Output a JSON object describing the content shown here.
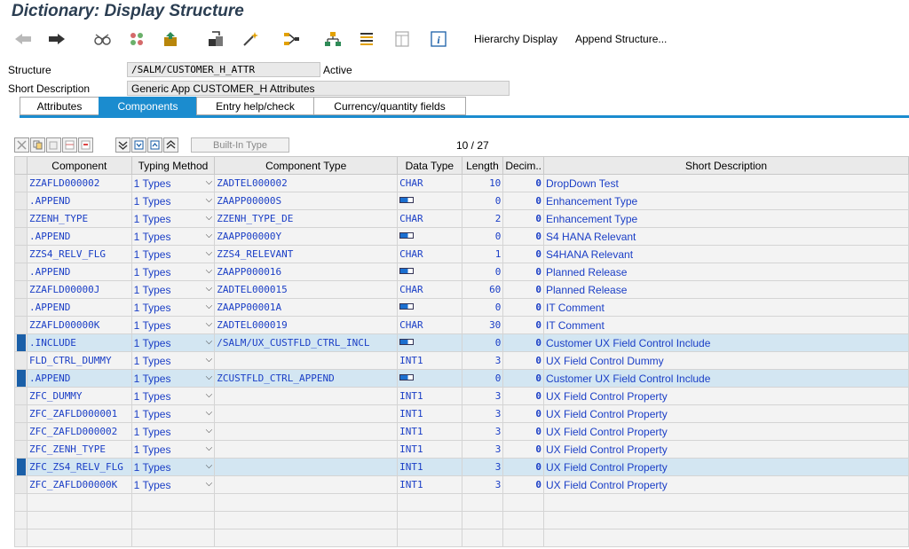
{
  "window": {
    "title": "Dictionary: Display Structure"
  },
  "toolbar": {
    "icons": [
      "back-arrow-icon",
      "forward-arrow-icon",
      "glasses-icon",
      "switch-display-change-icon",
      "other-object-icon",
      "check-icon",
      "activate-icon",
      "where-used-icon",
      "hierarchy-icon",
      "list-icon",
      "frame-icon",
      "info-icon"
    ],
    "hierarchy_label": "Hierarchy Display",
    "append_label": "Append Structure..."
  },
  "header": {
    "structure_label": "Structure",
    "structure_value": "/SALM/CUSTOMER_H_ATTR",
    "status": "Active",
    "short_desc_label": "Short Description",
    "short_desc_value": "Generic App CUSTOMER_H Attributes"
  },
  "tabs": [
    {
      "label": "Attributes"
    },
    {
      "label": "Components"
    },
    {
      "label": "Entry help/check"
    },
    {
      "label": "Currency/quantity fields"
    }
  ],
  "grid_toolbar": {
    "builtin_label": "Built-In Type",
    "counter": "10 /  27"
  },
  "columns": [
    "Component",
    "Typing Method",
    "Component Type",
    "Data Type",
    "Length",
    "Decim..",
    "Short Description"
  ],
  "rows": [
    {
      "component": "ZZAFLD000002",
      "typing": "1 Types",
      "ctype": "ZADTEL000002",
      "dtype": "CHAR",
      "length": "10",
      "dec": "0",
      "desc": "DropDown Test"
    },
    {
      "component": ".APPEND",
      "typing": "1 Types",
      "ctype": "ZAAPP00000S",
      "dtype": "",
      "length": "0",
      "dec": "0",
      "desc": "Enhancement Type"
    },
    {
      "component": "ZZENH_TYPE",
      "typing": "1 Types",
      "ctype": "ZZENH_TYPE_DE",
      "dtype": "CHAR",
      "length": "2",
      "dec": "0",
      "desc": "Enhancement Type"
    },
    {
      "component": ".APPEND",
      "typing": "1 Types",
      "ctype": "ZAAPP00000Y",
      "dtype": "",
      "length": "0",
      "dec": "0",
      "desc": "S4 HANA Relevant"
    },
    {
      "component": "ZZS4_RELV_FLG",
      "typing": "1 Types",
      "ctype": "ZZS4_RELEVANT",
      "dtype": "CHAR",
      "length": "1",
      "dec": "0",
      "desc": "S4HANA Relevant"
    },
    {
      "component": ".APPEND",
      "typing": "1 Types",
      "ctype": "ZAAPP000016",
      "dtype": "",
      "length": "0",
      "dec": "0",
      "desc": "Planned Release"
    },
    {
      "component": "ZZAFLD00000J",
      "typing": "1 Types",
      "ctype": "ZADTEL000015",
      "dtype": "CHAR",
      "length": "60",
      "dec": "0",
      "desc": "Planned Release"
    },
    {
      "component": ".APPEND",
      "typing": "1 Types",
      "ctype": "ZAAPP00001A",
      "dtype": "",
      "length": "0",
      "dec": "0",
      "desc": "IT Comment"
    },
    {
      "component": "ZZAFLD00000K",
      "typing": "1 Types",
      "ctype": "ZADTEL000019",
      "dtype": "CHAR",
      "length": "30",
      "dec": "0",
      "desc": "IT Comment"
    },
    {
      "component": ".INCLUDE",
      "typing": "1 Types",
      "ctype": "/SALM/UX_CUSTFLD_CTRL_INCL",
      "dtype": "",
      "length": "0",
      "dec": "0",
      "desc": "Customer UX Field Control Include"
    },
    {
      "component": "FLD_CTRL_DUMMY",
      "typing": "1 Types",
      "ctype": "",
      "dtype": "INT1",
      "length": "3",
      "dec": "0",
      "desc": "UX Field Control Dummy"
    },
    {
      "component": ".APPEND",
      "typing": "1 Types",
      "ctype": "ZCUSTFLD_CTRL_APPEND",
      "dtype": "",
      "length": "0",
      "dec": "0",
      "desc": "Customer UX Field Control Include"
    },
    {
      "component": "ZFC_DUMMY",
      "typing": "1 Types",
      "ctype": "",
      "dtype": "INT1",
      "length": "3",
      "dec": "0",
      "desc": "UX Field Control Property"
    },
    {
      "component": "ZFC_ZAFLD000001",
      "typing": "1 Types",
      "ctype": "",
      "dtype": "INT1",
      "length": "3",
      "dec": "0",
      "desc": "UX Field Control Property"
    },
    {
      "component": "ZFC_ZAFLD000002",
      "typing": "1 Types",
      "ctype": "",
      "dtype": "INT1",
      "length": "3",
      "dec": "0",
      "desc": "UX Field Control Property"
    },
    {
      "component": "ZFC_ZENH_TYPE",
      "typing": "1 Types",
      "ctype": "",
      "dtype": "INT1",
      "length": "3",
      "dec": "0",
      "desc": "UX Field Control Property"
    },
    {
      "component": "ZFC_ZS4_RELV_FLG",
      "typing": "1 Types",
      "ctype": "",
      "dtype": "INT1",
      "length": "3",
      "dec": "0",
      "desc": "UX Field Control Property"
    },
    {
      "component": "ZFC_ZAFLD00000K",
      "typing": "1 Types",
      "ctype": "",
      "dtype": "INT1",
      "length": "3",
      "dec": "0",
      "desc": "UX Field Control Property"
    }
  ],
  "selected_rows": [
    9,
    11,
    16
  ],
  "colors": {
    "accent": "#1b8ccf",
    "link_blue": "#1a3ec6",
    "title": "#2b3e52"
  }
}
